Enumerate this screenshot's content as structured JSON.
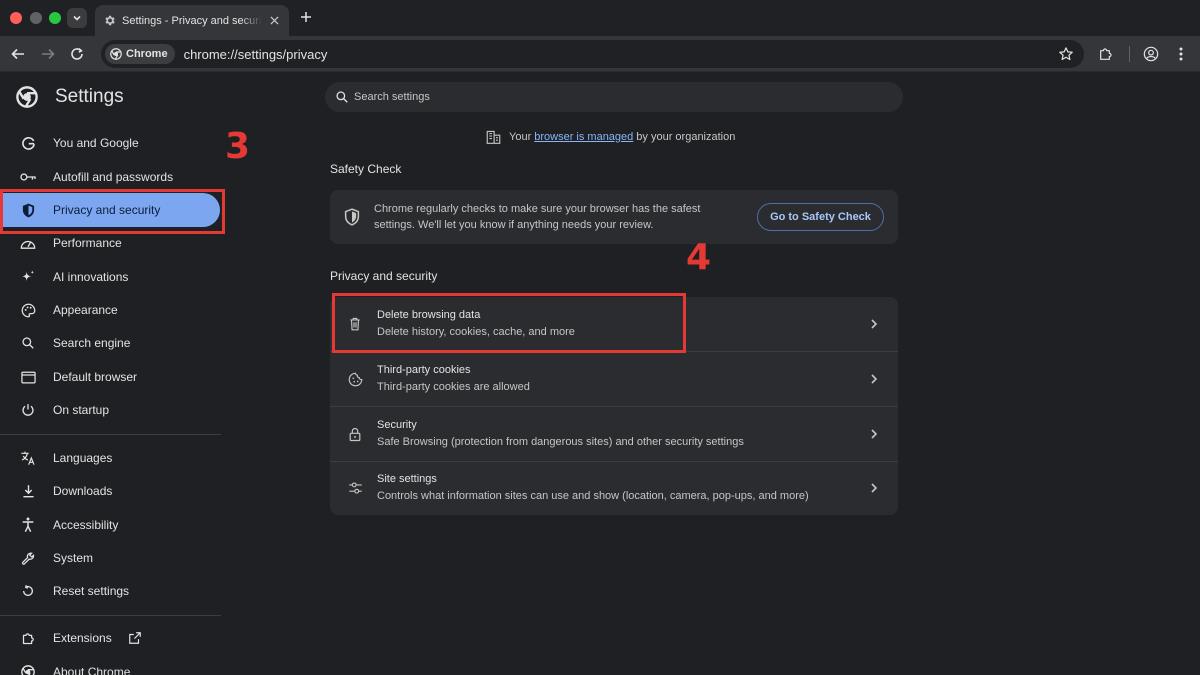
{
  "browser": {
    "tab_title": "Settings - Privacy and security",
    "chip_label": "Chrome",
    "url": "chrome://settings/privacy"
  },
  "settings": {
    "title": "Settings",
    "search_placeholder": "Search settings",
    "managed": {
      "prefix": "Your",
      "link": "browser is managed",
      "suffix": "by your organization"
    },
    "nav": [
      {
        "label": "You and Google",
        "icon": "google-g-icon"
      },
      {
        "label": "Autofill and passwords",
        "icon": "key-icon"
      },
      {
        "label": "Privacy and security",
        "icon": "shield-icon",
        "active": true
      },
      {
        "label": "Performance",
        "icon": "speedometer-icon"
      },
      {
        "label": "AI innovations",
        "icon": "sparkle-icon"
      },
      {
        "label": "Appearance",
        "icon": "palette-icon"
      },
      {
        "label": "Search engine",
        "icon": "search-icon"
      },
      {
        "label": "Default browser",
        "icon": "browser-window-icon"
      },
      {
        "label": "On startup",
        "icon": "power-icon"
      },
      {
        "label": "Languages",
        "icon": "translate-icon"
      },
      {
        "label": "Downloads",
        "icon": "download-icon"
      },
      {
        "label": "Accessibility",
        "icon": "accessibility-icon"
      },
      {
        "label": "System",
        "icon": "wrench-icon"
      },
      {
        "label": "Reset settings",
        "icon": "reset-icon"
      },
      {
        "label": "Extensions",
        "icon": "puzzle-icon"
      },
      {
        "label": "About Chrome",
        "icon": "chrome-icon"
      }
    ],
    "safety_check": {
      "heading": "Safety Check",
      "text": "Chrome regularly checks to make sure your browser has the safest settings. We'll let you know if anything needs your review.",
      "button": "Go to Safety Check"
    },
    "privacy": {
      "heading": "Privacy and security",
      "rows": [
        {
          "title": "Delete browsing data",
          "subtitle": "Delete history, cookies, cache, and more",
          "icon": "trash-icon"
        },
        {
          "title": "Third-party cookies",
          "subtitle": "Third-party cookies are allowed",
          "icon": "cookie-icon"
        },
        {
          "title": "Security",
          "subtitle": "Safe Browsing (protection from dangerous sites) and other security settings",
          "icon": "lock-icon"
        },
        {
          "title": "Site settings",
          "subtitle": "Controls what information sites can use and show (location, camera, pop-ups, and more)",
          "icon": "sliders-icon"
        }
      ]
    }
  },
  "annotations": {
    "step3": "3",
    "step4": "4"
  },
  "colors": {
    "accent": "#7ca7f0",
    "highlight": "#e53935",
    "background": "#1f2023",
    "card": "#2b2c2f"
  }
}
